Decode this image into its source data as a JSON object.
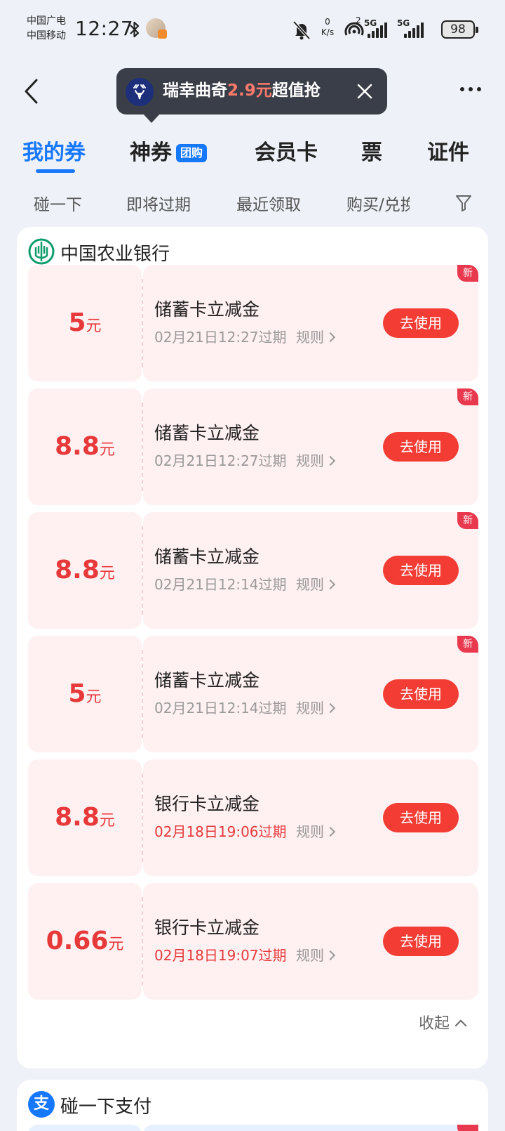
{
  "status_bar": {
    "carrier_1": "中国广电",
    "carrier_2": "中国移动",
    "time": "12:27",
    "net_speed_value": "0",
    "net_speed_unit": "K/s",
    "hotspot_count": "2",
    "network_label_1": "5G",
    "network_label_2": "5G",
    "battery": "98"
  },
  "promo": {
    "prefix": "瑞幸曲奇",
    "highlight": "2.9元",
    "suffix": "超值抢"
  },
  "tabs": [
    {
      "label": "我的券",
      "active": true
    },
    {
      "label": "神券",
      "badge": "团购"
    },
    {
      "label": "会员卡"
    },
    {
      "label": "票"
    },
    {
      "label": "证件"
    }
  ],
  "filters": [
    "碰一下",
    "即将过期",
    "最近领取",
    "购买/兑换"
  ],
  "bank_section": {
    "name": "中国农业银行",
    "coupons": [
      {
        "amount": "5",
        "unit": "元",
        "title": "储蓄卡立减金",
        "expiry": "02月21日12:27过期",
        "urgent": false,
        "rule": "规则",
        "button": "去使用",
        "new_tag": "新"
      },
      {
        "amount": "8.8",
        "unit": "元",
        "title": "储蓄卡立减金",
        "expiry": "02月21日12:27过期",
        "urgent": false,
        "rule": "规则",
        "button": "去使用",
        "new_tag": "新"
      },
      {
        "amount": "8.8",
        "unit": "元",
        "title": "储蓄卡立减金",
        "expiry": "02月21日12:14过期",
        "urgent": false,
        "rule": "规则",
        "button": "去使用",
        "new_tag": "新"
      },
      {
        "amount": "5",
        "unit": "元",
        "title": "储蓄卡立减金",
        "expiry": "02月21日12:14过期",
        "urgent": false,
        "rule": "规则",
        "button": "去使用",
        "new_tag": "新"
      },
      {
        "amount": "8.8",
        "unit": "元",
        "title": "银行卡立减金",
        "expiry": "02月18日19:06过期",
        "urgent": true,
        "rule": "规则",
        "button": "去使用",
        "new_tag": ""
      },
      {
        "amount": "0.66",
        "unit": "元",
        "title": "银行卡立减金",
        "expiry": "02月18日19:07过期",
        "urgent": true,
        "rule": "规则",
        "button": "去使用",
        "new_tag": ""
      }
    ],
    "collapse_label": "收起"
  },
  "pay_section": {
    "logo_char": "支",
    "name": "碰一下支付"
  },
  "colors": {
    "accent_blue": "#1677ff",
    "coupon_red": "#e8393a",
    "button_red": "#f23c34",
    "coupon_bg": "#fff0f1",
    "page_bg": "#eef2f8"
  }
}
